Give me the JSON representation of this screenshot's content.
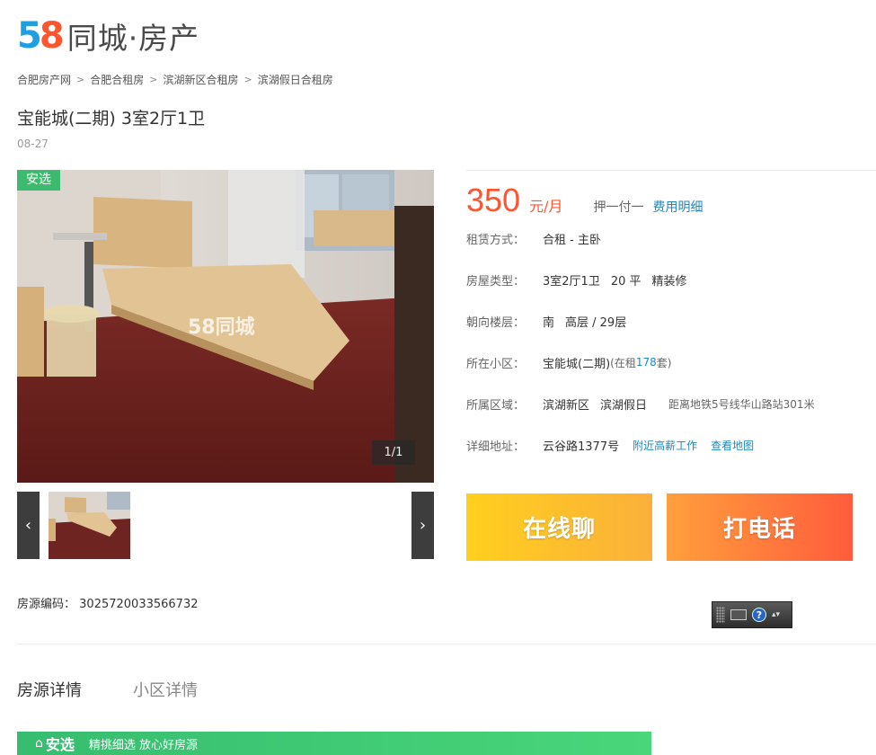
{
  "logo": {
    "num_5": "5",
    "num_8": "8",
    "text": "同城·房产"
  },
  "breadcrumb": [
    "合肥房产网",
    "合肥合租房",
    "滨湖新区合租房",
    "滨湖假日合租房"
  ],
  "breadcrumb_sep": ">",
  "title": "宝能城(二期) 3室2厅1卫",
  "date": "08-27",
  "photo": {
    "badge": "安选",
    "watermark": "58同城",
    "counter": "1/1",
    "prev": "‹",
    "next": "›"
  },
  "price": {
    "amount": "350",
    "unit": "元/月",
    "deposit": "押一付一",
    "fee_link": "费用明细"
  },
  "info": {
    "rent_type": {
      "label": "租赁方式：",
      "value": "合租 - 主卧"
    },
    "house_type": {
      "label": "房屋类型：",
      "rooms": "3室2厅1卫",
      "area": "20 平",
      "decor": "精装修"
    },
    "orientation": {
      "label": "朝向楼层：",
      "direction": "南",
      "floor": "高层 / 29层"
    },
    "community": {
      "label": "所在小区：",
      "name": "宝能城(二期)",
      "renting_prefix": "(在租 ",
      "renting_count": "178",
      "renting_suffix": " 套)"
    },
    "district": {
      "label": "所属区域：",
      "area": "滨湖新区",
      "sub": "滨湖假日",
      "subway": "距离地铁5号线华山路站301米"
    },
    "address": {
      "label": "详细地址：",
      "value": "云谷路1377号",
      "link1": "附近高薪工作",
      "link2": "查看地图"
    }
  },
  "buttons": {
    "chat": "在线聊",
    "call": "打电话"
  },
  "listing_code": {
    "label": "房源编码：",
    "value": "3025720033566732"
  },
  "toolbar_widget": {
    "help": "?",
    "arrows": "▴▾"
  },
  "tabs": [
    "房源详情",
    "小区详情"
  ],
  "banner": {
    "icon": "⌂",
    "brand": "安选",
    "slogan": "精挑细选 放心好房源"
  },
  "colors": {
    "accent": "#ff552e",
    "link": "#1d89c1",
    "green": "#3cbb6e"
  }
}
